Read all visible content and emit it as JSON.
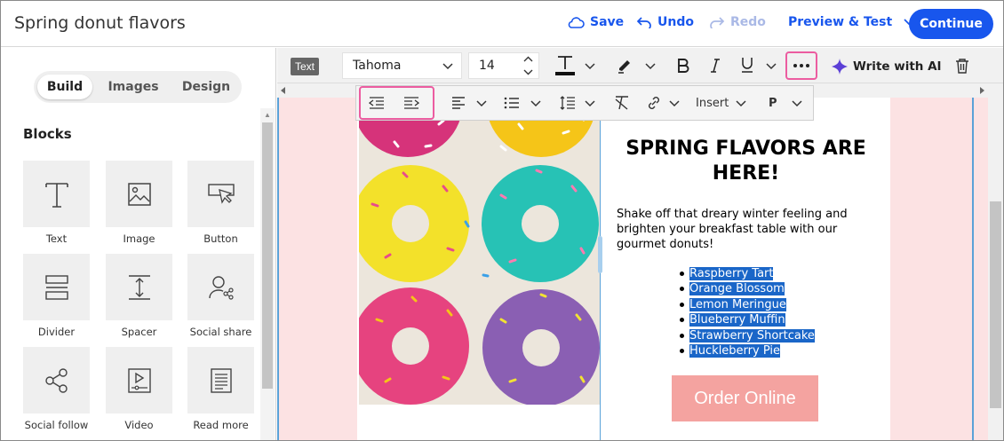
{
  "header": {
    "title": "Spring donut flavors",
    "save_label": "Save",
    "undo_label": "Undo",
    "redo_label": "Redo",
    "preview_label": "Preview & Test",
    "continue_label": "Continue"
  },
  "left_panel": {
    "tabs": [
      {
        "label": "Build",
        "active": true
      },
      {
        "label": "Images",
        "active": false
      },
      {
        "label": "Design",
        "active": false
      }
    ],
    "blocks_title": "Blocks",
    "blocks": [
      {
        "label": "Text",
        "icon": "text-icon"
      },
      {
        "label": "Image",
        "icon": "image-icon"
      },
      {
        "label": "Button",
        "icon": "button-icon"
      },
      {
        "label": "Divider",
        "icon": "divider-icon"
      },
      {
        "label": "Spacer",
        "icon": "spacer-icon"
      },
      {
        "label": "Social share",
        "icon": "social-share-icon"
      },
      {
        "label": "Social follow",
        "icon": "social-follow-icon"
      },
      {
        "label": "Video",
        "icon": "video-icon"
      },
      {
        "label": "Read more",
        "icon": "read-more-icon"
      }
    ]
  },
  "toolbar": {
    "element_tag": "Text",
    "font_family": "Tahoma",
    "font_size": "14",
    "write_ai_label": "Write with AI",
    "insert_label": "Insert",
    "paragraph_label": "P"
  },
  "email": {
    "headline": "SPRING FLAVORS ARE HERE!",
    "body": "Shake off that dreary winter feeling and brighten your breakfast table with our gourmet donuts!",
    "flavors": [
      "Raspberry Tart",
      "Orange Blossom",
      "Lemon Meringue",
      "Blueberry Muffin",
      "Strawberry Shortcake",
      "Huckleberry Pie"
    ],
    "cta_label": "Order Online"
  },
  "colors": {
    "brand_blue": "#1856ed",
    "highlight_pink": "#ec5ca0",
    "canvas_bg_pink": "#fce2e3",
    "cta_bg": "#f4a3a0",
    "selection_blue": "#1a66c8"
  }
}
